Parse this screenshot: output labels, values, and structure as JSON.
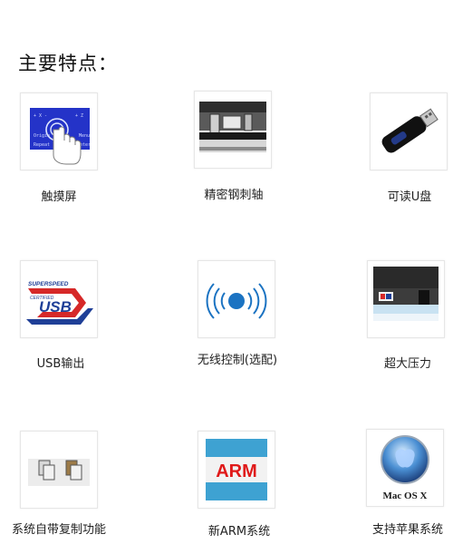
{
  "title": "主要特点：",
  "features": [
    {
      "label": "触摸屏",
      "icon": "touchscreen-icon"
    },
    {
      "label": "精密钢刺轴",
      "icon": "steel-roller-icon"
    },
    {
      "label": "可读U盘",
      "icon": "usb-drive-icon"
    },
    {
      "label": "USB输出",
      "icon": "superspeed-usb-icon"
    },
    {
      "label": "无线控制(选配)",
      "icon": "wireless-icon"
    },
    {
      "label": "超大压力",
      "icon": "pressure-icon"
    },
    {
      "label": "系统自带复制功能",
      "icon": "copy-icon"
    },
    {
      "label": "新ARM系统",
      "icon": "arm-chip-icon"
    },
    {
      "label": "支持苹果系统",
      "icon": "mac-os-x-icon"
    }
  ],
  "graphic_text": {
    "usb_superspeed": "SUPERSPEED",
    "usb_certified": "CERTIFIED",
    "usb_logo": "USB",
    "arm_logo": "ARM",
    "mac_logo": "Mac OS X",
    "touch_words": [
      "Origin",
      "Menu",
      "Repeat",
      "Enter"
    ]
  },
  "colors": {
    "touch_blue": "#2433c8",
    "usb_blue": "#1f3f97",
    "usb_red": "#d62828",
    "arm_bg": "#3ea2d2",
    "arm_red": "#e01919",
    "wireless_blue": "#1b73c2"
  }
}
